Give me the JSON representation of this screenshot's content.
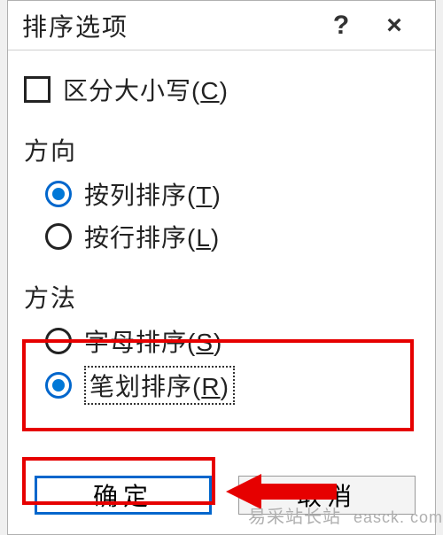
{
  "title": "排序选项",
  "help_symbol": "?",
  "close_symbol": "×",
  "case_sensitive_label": "区分大小写(C)",
  "direction": {
    "title": "方向",
    "by_column": "按列排序(T)",
    "by_row": "按行排序(L)"
  },
  "method": {
    "title": "方法",
    "alpha": "字母排序(S)",
    "stroke": "笔划排序(R)"
  },
  "buttons": {
    "ok": "确定",
    "cancel": "取消"
  },
  "watermark": {
    "cn": "易采站长站",
    "en": "easck. com"
  }
}
